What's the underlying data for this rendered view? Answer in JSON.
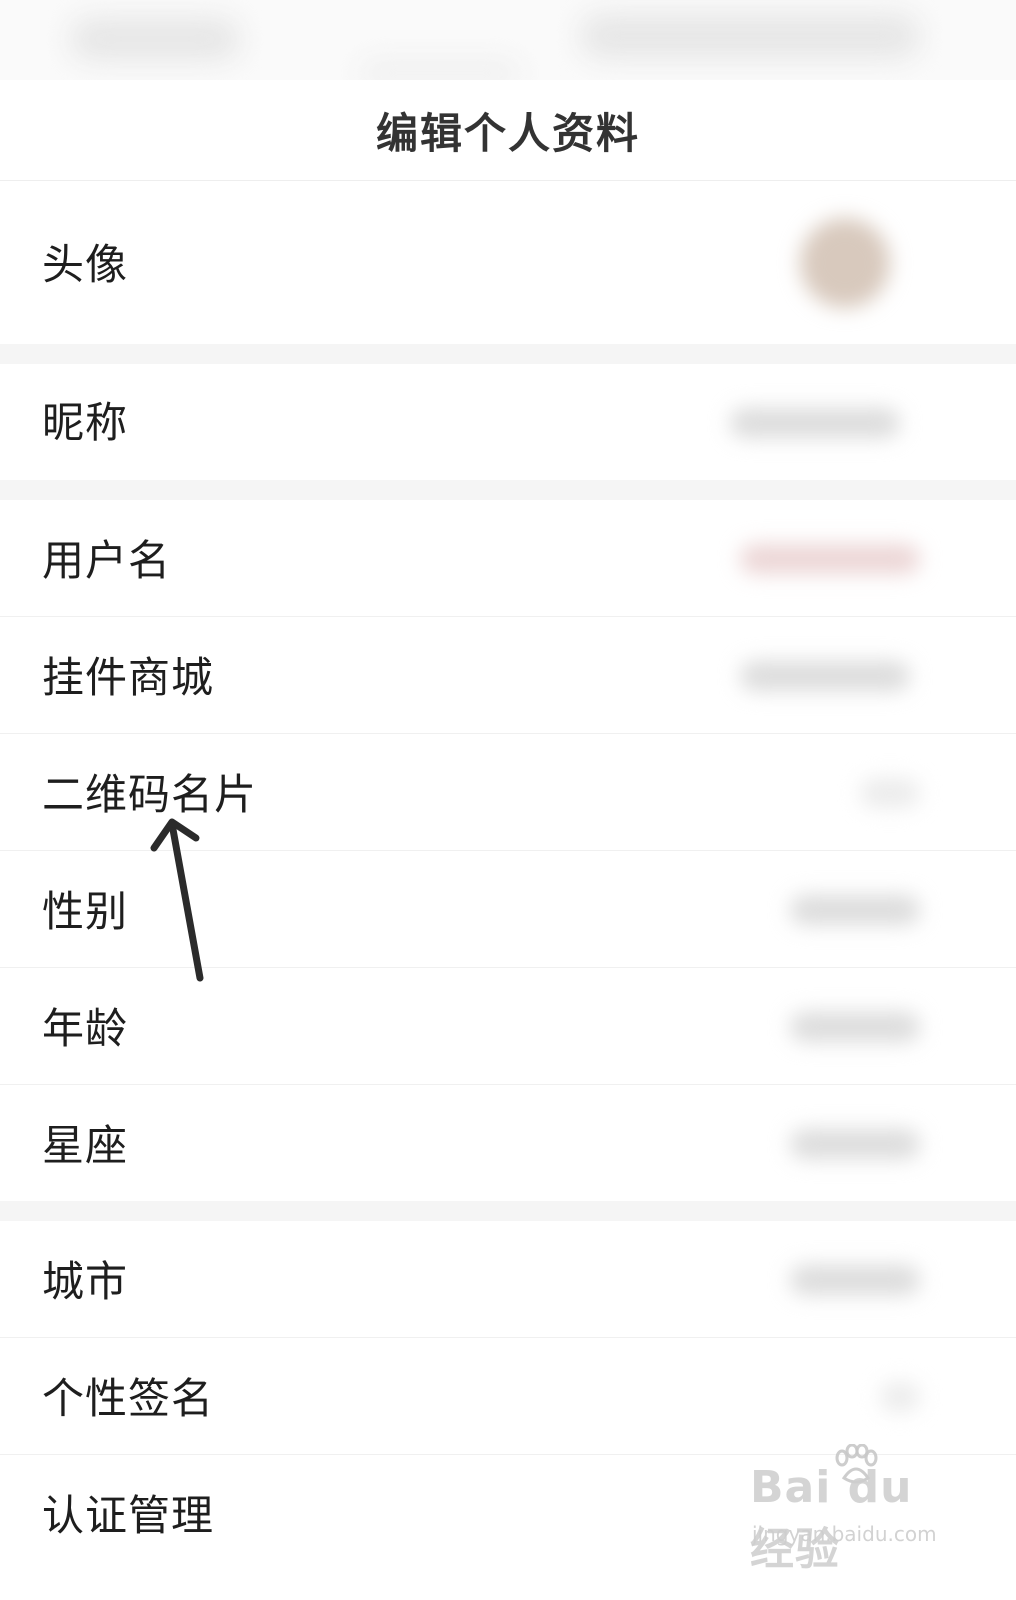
{
  "header": {
    "title": "编辑个人资料"
  },
  "rows": [
    {
      "label": "头像"
    },
    {
      "label": "昵称"
    },
    {
      "label": "用户名"
    },
    {
      "label": "挂件商城"
    },
    {
      "label": "二维码名片"
    },
    {
      "label": "性别"
    },
    {
      "label": "年龄"
    },
    {
      "label": "星座"
    },
    {
      "label": "城市"
    },
    {
      "label": "个性签名"
    },
    {
      "label": "认证管理"
    }
  ],
  "watermark": {
    "logo_text": "Bai du 经验",
    "url_text": "jingyan.baidu.com"
  },
  "icons": {
    "annotation": "arrow-up-icon",
    "watermark": "baidu-paw-icon"
  }
}
